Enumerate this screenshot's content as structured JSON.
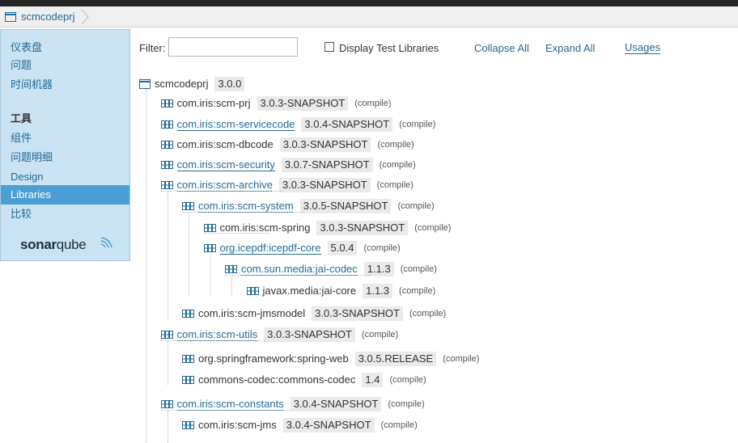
{
  "breadcrumb": {
    "project": "scmcodeprj"
  },
  "sidebar": {
    "items_top": [
      "仪表盘",
      "问题",
      "时间机器"
    ],
    "section_heading": "工具",
    "items_tools": [
      "组件",
      "问题明细",
      "Design",
      "Libraries",
      "比较"
    ],
    "selected": "Libraries",
    "logo_prefix": "sonar",
    "logo_suffix": "qube"
  },
  "toolbar": {
    "filter_label": "Filter:",
    "filter_value": "",
    "checkbox_label": "Display Test Libraries",
    "checkbox_checked": false,
    "collapse_all": "Collapse All",
    "expand_all": "Expand All",
    "usages": "Usages"
  },
  "tree": {
    "root": {
      "name": "scmcodeprj",
      "version": "3.0.0"
    },
    "nodes": [
      {
        "name": "com.iris:scm-prj",
        "version": "3.0.3-SNAPSHOT",
        "scope": "(compile)",
        "depth": 1,
        "link": false
      },
      {
        "name": "com.iris:scm-servicecode",
        "version": "3.0.4-SNAPSHOT",
        "scope": "(compile)",
        "depth": 1,
        "link": true
      },
      {
        "name": "com.iris:scm-dbcode",
        "version": "3.0.3-SNAPSHOT",
        "scope": "(compile)",
        "depth": 1,
        "link": false
      },
      {
        "name": "com.iris:scm-security",
        "version": "3.0.7-SNAPSHOT",
        "scope": "(compile)",
        "depth": 1,
        "link": true
      },
      {
        "name": "com.iris:scm-archive",
        "version": "3.0.3-SNAPSHOT",
        "scope": "(compile)",
        "depth": 1,
        "link": true
      },
      {
        "name": "com.iris:scm-system",
        "version": "3.0.5-SNAPSHOT",
        "scope": "(compile)",
        "depth": 2,
        "link": true
      },
      {
        "name": "com.iris:scm-spring",
        "version": "3.0.3-SNAPSHOT",
        "scope": "(compile)",
        "depth": 3,
        "link": false
      },
      {
        "name": "org.icepdf:icepdf-core",
        "version": "5.0.4",
        "scope": "(compile)",
        "depth": 3,
        "link": true
      },
      {
        "name": "com.sun.media:jai-codec",
        "version": "1.1.3",
        "scope": "(compile)",
        "depth": 4,
        "link": true
      },
      {
        "name": "javax.media:jai-core",
        "version": "1.1.3",
        "scope": "(compile)",
        "depth": 5,
        "link": false
      },
      {
        "name": "com.iris:scm-jmsmodel",
        "version": "3.0.3-SNAPSHOT",
        "scope": "(compile)",
        "depth": 2,
        "link": false
      },
      {
        "name": "com.iris:scm-utils",
        "version": "3.0.3-SNAPSHOT",
        "scope": "(compile)",
        "depth": 1,
        "link": true
      },
      {
        "name": "org.springframework:spring-web",
        "version": "3.0.5.RELEASE",
        "scope": "(compile)",
        "depth": 2,
        "link": false
      },
      {
        "name": "commons-codec:commons-codec",
        "version": "1.4",
        "scope": "(compile)",
        "depth": 2,
        "link": false
      },
      {
        "name": "com.iris:scm-constants",
        "version": "3.0.4-SNAPSHOT",
        "scope": "(compile)",
        "depth": 1,
        "link": true
      },
      {
        "name": "com.iris:scm-jms",
        "version": "3.0.4-SNAPSHOT",
        "scope": "(compile)",
        "depth": 2,
        "link": false
      }
    ]
  },
  "colors": {
    "link": "#236a97",
    "sidebar_bg": "#cae3f2",
    "selected_bg": "#4b9fd5"
  }
}
